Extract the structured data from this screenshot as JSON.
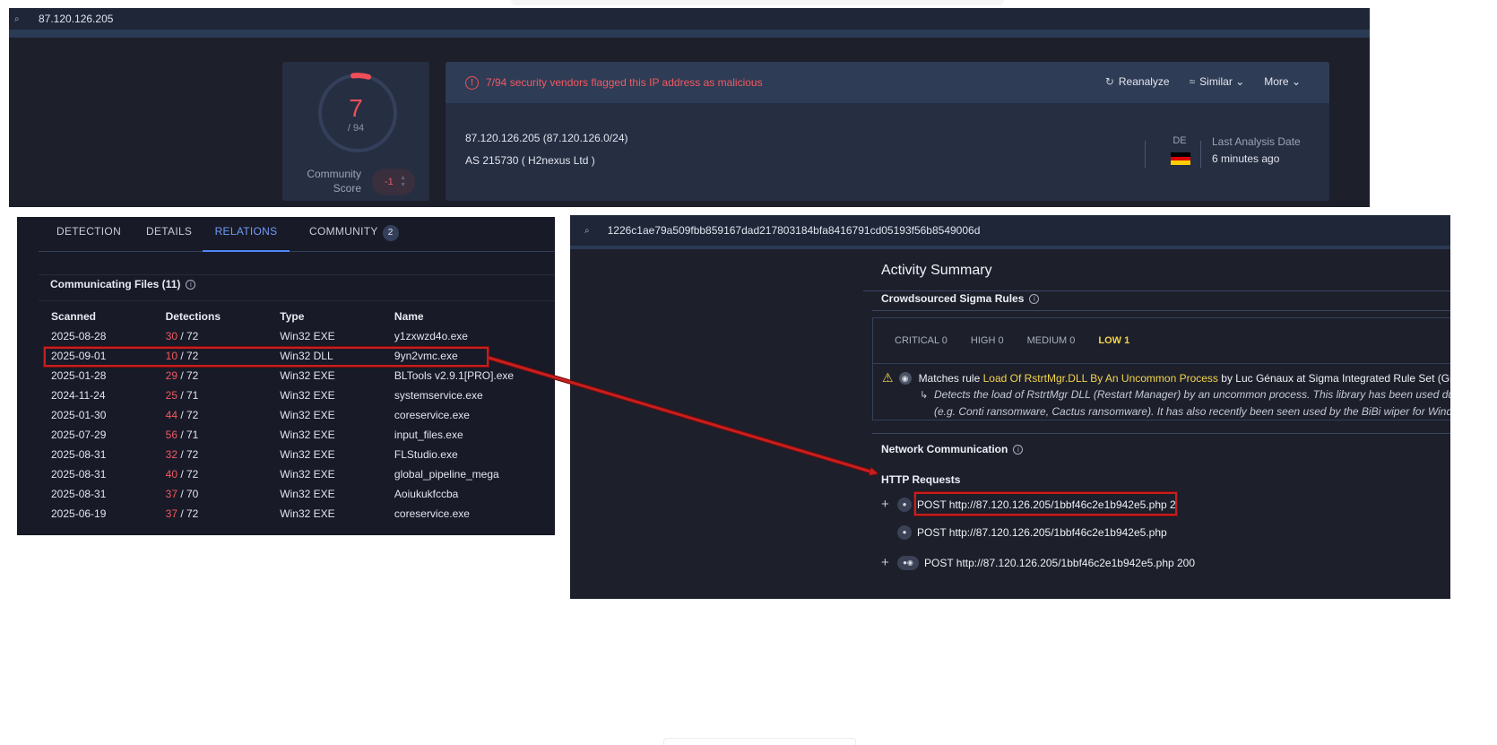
{
  "top": {
    "search_value": "87.120.126.205",
    "score": "7",
    "score_total": "/ 94",
    "community_label": "Community Score",
    "community_value": "-1",
    "alert_text": "7/94 security vendors flagged this IP address as malicious",
    "actions": {
      "reanalyze": "Reanalyze",
      "similar": "Similar",
      "more": "More"
    },
    "ip_line": "87.120.126.205  (87.120.126.0/24)",
    "as_line": "AS 215730  ( H2nexus Ltd )",
    "country": "DE",
    "last_analysis_label": "Last Analysis Date",
    "last_analysis_value": "6 minutes ago"
  },
  "relations": {
    "tabs": [
      "DETECTION",
      "DETAILS",
      "RELATIONS",
      "COMMUNITY"
    ],
    "community_badge": "2",
    "section_title": "Communicating Files  (11)",
    "columns": [
      "Scanned",
      "Detections",
      "Type",
      "Name"
    ],
    "rows": [
      {
        "scanned": "2025-08-28",
        "det": "30",
        "total": " / 72",
        "type": "Win32 EXE",
        "name": "y1zxwzd4o.exe"
      },
      {
        "scanned": "2025-09-01",
        "det": "10",
        "total": " / 72",
        "type": "Win32 DLL",
        "name": "9yn2vmc.exe"
      },
      {
        "scanned": "2025-01-28",
        "det": "29",
        "total": " / 72",
        "type": "Win32 EXE",
        "name": "BLTools v2.9.1[PRO].exe"
      },
      {
        "scanned": "2024-11-24",
        "det": "25",
        "total": " / 71",
        "type": "Win32 EXE",
        "name": "systemservice.exe"
      },
      {
        "scanned": "2025-01-30",
        "det": "44",
        "total": " / 72",
        "type": "Win32 EXE",
        "name": "coreservice.exe"
      },
      {
        "scanned": "2025-07-29",
        "det": "56",
        "total": " / 71",
        "type": "Win32 EXE",
        "name": "input_files.exe"
      },
      {
        "scanned": "2025-08-31",
        "det": "32",
        "total": " / 72",
        "type": "Win32 EXE",
        "name": "FLStudio.exe"
      },
      {
        "scanned": "2025-08-31",
        "det": "40",
        "total": " / 72",
        "type": "Win32 EXE",
        "name": "global_pipeline_mega"
      },
      {
        "scanned": "2025-08-31",
        "det": "37",
        "total": " / 70",
        "type": "Win32 EXE",
        "name": "Aoiukukfccba"
      },
      {
        "scanned": "2025-06-19",
        "det": "37",
        "total": " / 72",
        "type": "Win32 EXE",
        "name": "coreservice.exe"
      }
    ]
  },
  "activity": {
    "search_value": "1226c1ae79a509fbb859167dad217803184bfa8416791cd05193f56b8549006d",
    "title": "Activity Summary",
    "sigma_title": "Crowdsourced Sigma Rules",
    "levels": {
      "critical": "CRITICAL 0",
      "high": "HIGH 0",
      "medium": "MEDIUM 0",
      "low": "LOW 1"
    },
    "rule_prefix": "Matches rule ",
    "rule_name": "Load Of RstrtMgr.DLL By An Uncommon Process",
    "rule_suffix": " by Luc Génaux at Sigma Integrated Rule Set (GitHub)",
    "rule_desc_1": "Detects the load of RstrtMgr DLL (Restart Manager) by an uncommon process. This library has been used during",
    "rule_desc_2": "(e.g. Conti ransomware, Cactus ransomware). It has also recently been seen used by the BiBi wiper for Windows.",
    "network_title": "Network Communication",
    "http_title": "HTTP Requests",
    "requests": [
      "POST http://87.120.126.205/1bbf46c2e1b942e5.php 2",
      "POST http://87.120.126.205/1bbf46c2e1b942e5.php",
      "POST http://87.120.126.205/1bbf46c2e1b942e5.php 200"
    ]
  },
  "colors": {
    "malicious": "#ef4e58",
    "accent": "#4f86f7",
    "highlight": "#c81e1e",
    "low": "#f4d54b"
  }
}
